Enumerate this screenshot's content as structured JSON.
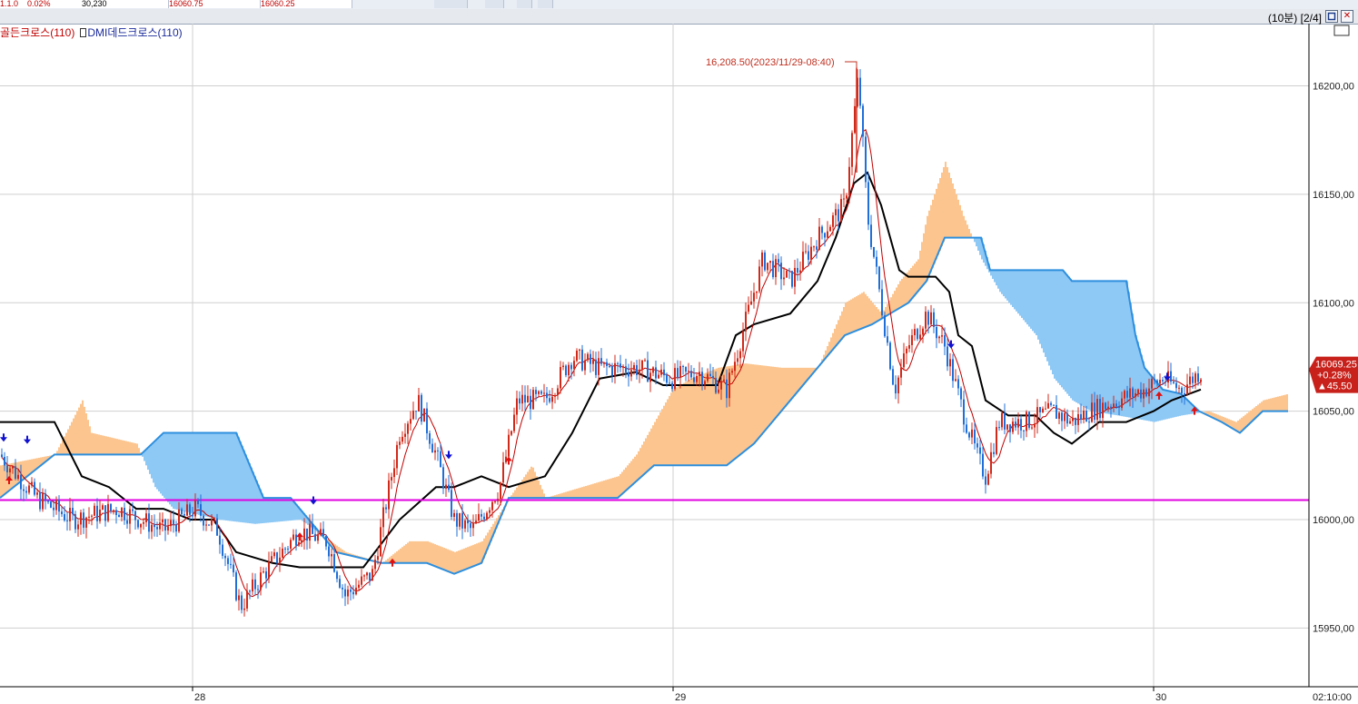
{
  "toolbar": {
    "cells": [
      "1.1.0",
      "0.02%",
      "30,230",
      "16060.75",
      "16060.25"
    ]
  },
  "window": {
    "interval_info": "(10분) [2/4]",
    "restore_icon": "restore-window-icon",
    "close_icon": "close-window-icon",
    "close_symbol": "✕"
  },
  "legend": {
    "golden_cross": "골든크로스(110)",
    "dmi_dead_cross": "DMI데드크로스(110)"
  },
  "colors": {
    "up_candle": "#d02a1a",
    "down_candle": "#1f6fd6",
    "cloud_bull": "#fcc58f",
    "cloud_bear": "#8ec8f5",
    "span_b": "#2d8fde",
    "kijun": "#000000",
    "tenkan": "#c00000",
    "ref_line": "#e000e0",
    "grid": "#cfcfcf"
  },
  "chart_data": {
    "type": "candlestick",
    "title": "",
    "y_ticks": [
      "16200.00",
      "16150.00",
      "16100.00",
      "16050.00",
      "16000.00",
      "15950.00"
    ],
    "ylim": [
      15930,
      16220
    ],
    "x_ticks": [
      "28",
      "29",
      "30"
    ],
    "time_label": "02:10:00",
    "reference_line": 16009,
    "max_annotation": "16,208.50(2023/11/29-08:40)",
    "max_value": 16208.5,
    "current_price": {
      "price": "16069.25",
      "change_pct": "+0.28%",
      "change": "▲45.50"
    },
    "grid": true
  }
}
